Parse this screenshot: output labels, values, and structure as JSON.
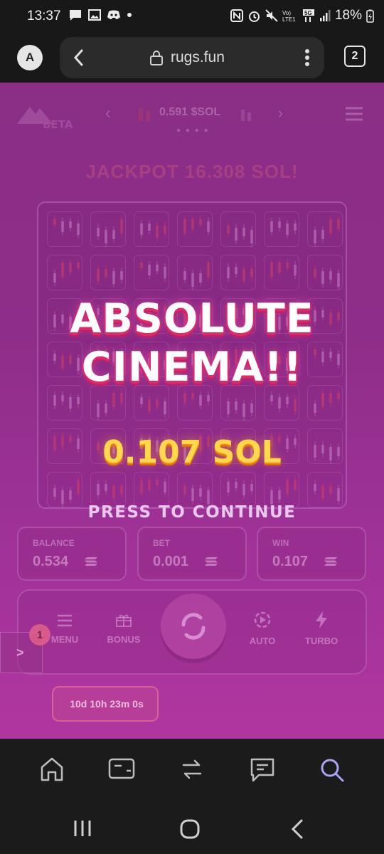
{
  "status_bar": {
    "time": "13:37",
    "battery": "18%",
    "network_label": "5G",
    "volte_label": "Vo) LTE1"
  },
  "browser": {
    "account_initial": "A",
    "url": "rugs.fun",
    "tab_count": "2"
  },
  "game": {
    "logo_text": "BETA",
    "price": "0.591 $SOL",
    "jackpot": "JACKPOT 16.308 SOL!",
    "headline_line1": "ABSOLUTE",
    "headline_line2": "CINEMA!!",
    "win_amount": "0.107 SOL",
    "press_prompt": "PRESS TO CONTINUE",
    "stats": [
      {
        "label": "BALANCE",
        "value": "0.534"
      },
      {
        "label": "BET",
        "value": "0.001"
      },
      {
        "label": "WIN",
        "value": "0.107"
      }
    ],
    "controls": {
      "menu": "MENU",
      "bonus": "BONUS",
      "auto": "AUTO",
      "turbo": "TURBO"
    },
    "side_button": {
      "arrow": ">",
      "badge": "1"
    },
    "timer": "10d 10h 23m 0s"
  },
  "colors": {
    "page_bg": "#8f2e8a",
    "headline_shadow": "#e0296a",
    "win_amount": "#ffd94a"
  },
  "icons": [
    "back-icon",
    "lock-icon",
    "more-icon",
    "home-icon",
    "wallet-icon",
    "swap-icon",
    "chat-icon",
    "search-icon",
    "recents-icon",
    "home-circle-icon",
    "back-chevron-icon"
  ]
}
